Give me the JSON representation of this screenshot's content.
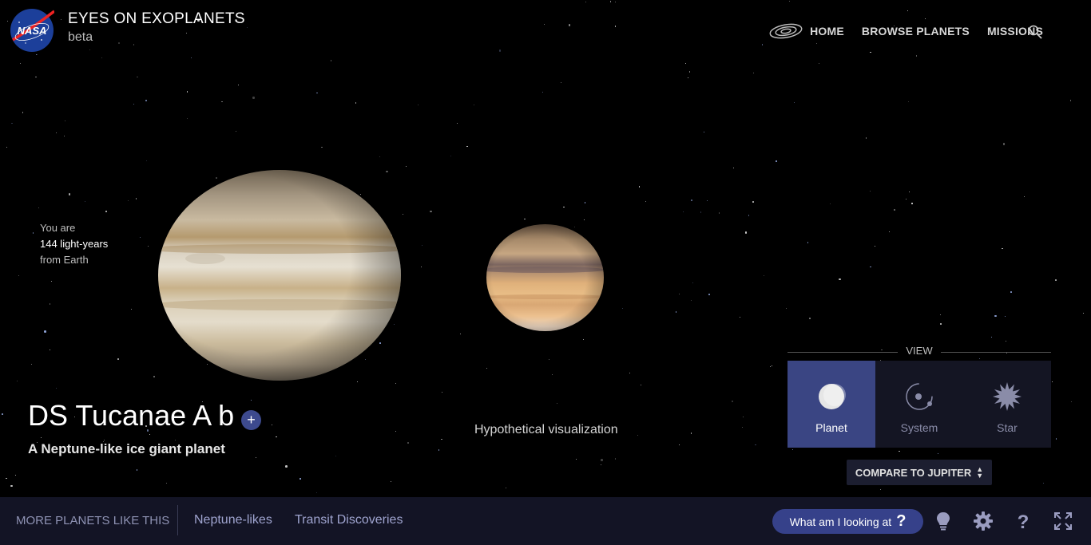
{
  "header": {
    "title": "EYES ON EXOPLANETS",
    "subtitle": "beta",
    "logo_text": "NASA",
    "nav": [
      "HOME",
      "BROWSE PLANETS",
      "MISSIONS"
    ]
  },
  "distance": {
    "prefix": "You are",
    "value": "144 light-years",
    "suffix": "from Earth"
  },
  "planet": {
    "name": "DS Tucanae A b",
    "add_label": "+",
    "description": "A Neptune-like ice giant planet",
    "visualization_note": "Hypothetical visualization"
  },
  "view": {
    "label": "VIEW",
    "options": [
      "Planet",
      "System",
      "Star"
    ],
    "active": "Planet"
  },
  "compare": {
    "label": "COMPARE TO JUPITER"
  },
  "bottom_bar": {
    "more_label": "MORE PLANETS LIKE THIS",
    "links": [
      "Neptune-likes",
      "Transit Discoveries"
    ],
    "what_label": "What am I looking at",
    "what_glyph": "?"
  },
  "icons": [
    "galaxy-icon",
    "search-icon",
    "lightbulb-icon",
    "settings-icon",
    "help-icon",
    "fullscreen-icon"
  ],
  "colors": {
    "accent": "#3a4583",
    "bar": "#131425",
    "link": "#9fa4cf"
  }
}
